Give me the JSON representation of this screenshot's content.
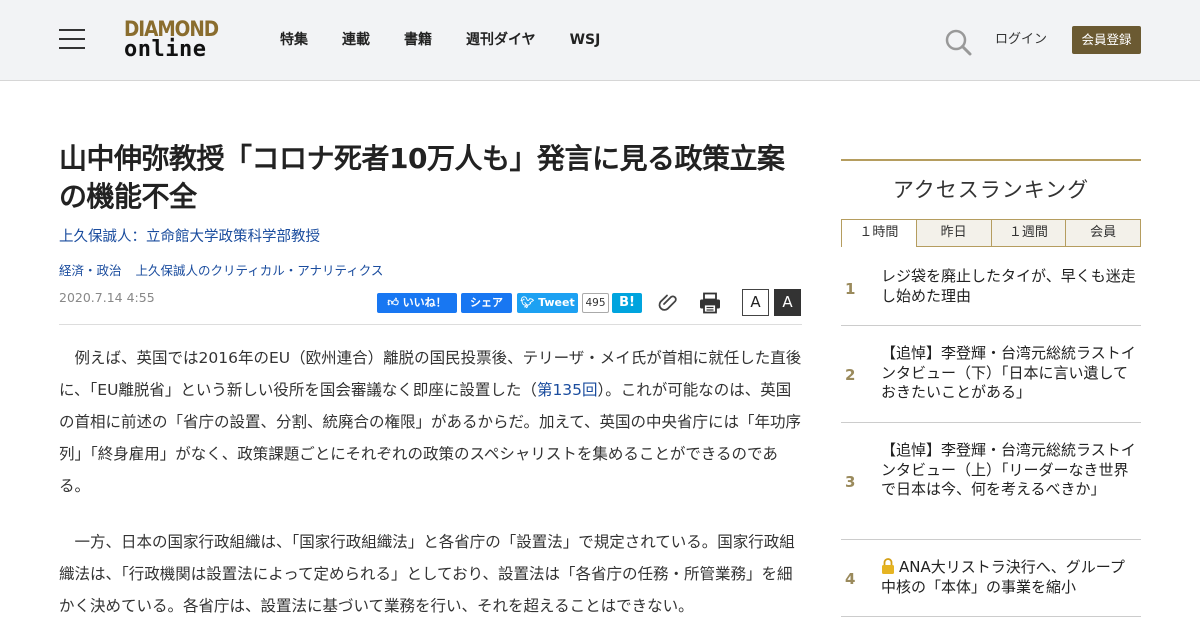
{
  "header": {
    "logo_line1": "DIAMOND",
    "logo_line2": "online",
    "nav": [
      "特集",
      "連載",
      "書籍",
      "週刊ダイヤ",
      "WSJ"
    ],
    "login_label": "ログイン",
    "register_label": "会員登録"
  },
  "article": {
    "title": "山中伸弥教授「コロナ死者10万人も」発言に見る政策立案の機能不全",
    "author": "上久保誠人：立命館大学政策科学部教授",
    "tags": [
      "経済・政治",
      "上久保誠人のクリティカル・アナリティクス"
    ],
    "date": "2020.7.14 4:55",
    "p1_before": "　例えば、英国では2016年のEU（欧州連合）離脱の国民投票後、テリーザ・メイ氏が首相に就任した直後に、「EU離脱省」という新しい役所を国会審議なく即座に設置した（",
    "p1_link": "第135回",
    "p1_after": "）。これが可能なのは、英国の首相に前述の「省庁の設置、分割、統廃合の権限」があるからだ。加えて、英国の中央省庁には「年功序列」「終身雇用」がなく、政策課題ごとにそれぞれの政策のスペシャリストを集めることができるのである。",
    "p2": "　一方、日本の国家行政組織は、「国家行政組織法」と各省庁の「設置法」で規定されている。国家行政組織法は、「行政機関は設置法によって定められる」としており、設置法は「各省庁の任務・所管業務」を細かく決めている。各省庁は、設置法に基づいて業務を行い、それを超えることはできない。"
  },
  "share": {
    "fb_like": "いいね！",
    "fb_share": "シェア",
    "tweet": "Tweet",
    "hatena_count": "495",
    "hatena": "B!",
    "font_small": "A",
    "font_large": "A"
  },
  "ranking": {
    "title": "アクセスランキング",
    "tabs": [
      "１時間",
      "昨日",
      "１週間",
      "会員"
    ],
    "items": [
      {
        "num": "1",
        "text": "レジ袋を廃止したタイが、早くも迷走し始めた理由"
      },
      {
        "num": "2",
        "text": "【追悼】李登輝・台湾元総統ラストインタビュー（下）「日本に言い遺しておきたいことがある」"
      },
      {
        "num": "3",
        "text": "【追悼】李登輝・台湾元総統ラストインタビュー（上）「リーダーなき世界で日本は今、何を考えるべきか」"
      },
      {
        "num": "4",
        "text": "ANA大リストラ決行へ、グループ中核の「本体」の事業を縮小"
      }
    ]
  },
  "colors": {
    "accent_gold": "#b59d5f",
    "register_bg": "#6b5a32",
    "link_blue": "#1a4c9e"
  }
}
